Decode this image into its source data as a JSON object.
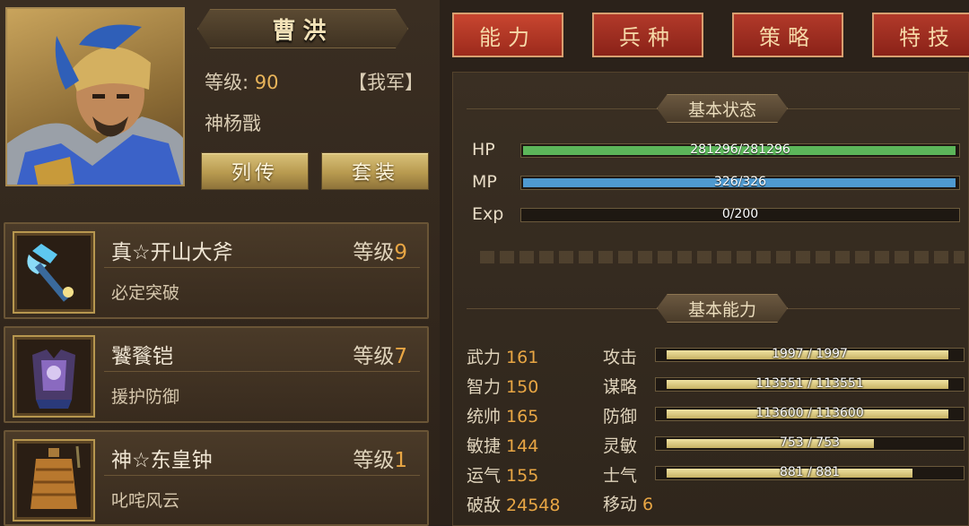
{
  "hero": {
    "name": "曹洪",
    "level_label": "等级:",
    "level_value": "90",
    "faction": "【我军】",
    "title": "神杨戬",
    "btn_biography": "列传",
    "btn_set": "套装"
  },
  "tabs": [
    {
      "label": "能力"
    },
    {
      "label": "兵种"
    },
    {
      "label": "策略"
    },
    {
      "label": "特技"
    }
  ],
  "equipment": [
    {
      "name": "真☆开山大斧",
      "level_label": "等级",
      "level": "9",
      "desc": "必定突破",
      "icon": "axe-icon"
    },
    {
      "name": "饕餮铠",
      "level_label": "等级",
      "level": "7",
      "desc": "援护防御",
      "icon": "armor-icon"
    },
    {
      "name": "神☆东皇钟",
      "level_label": "等级",
      "level": "1",
      "desc": "叱咤风云",
      "icon": "bell-icon"
    }
  ],
  "basic_status": {
    "title": "基本状态",
    "bars": [
      {
        "label": "HP",
        "text": "281296/281296",
        "fraction": 1.0,
        "color": "#5cb65a"
      },
      {
        "label": "MP",
        "text": "326/326",
        "fraction": 1.0,
        "color": "#4f9ad0"
      },
      {
        "label": "Exp",
        "text": "0/200",
        "fraction": 0.0,
        "color": "#c8b060"
      }
    ]
  },
  "basic_ability": {
    "title": "基本能力",
    "stats": [
      {
        "label": "武力",
        "value": "161"
      },
      {
        "label": "智力",
        "value": "150"
      },
      {
        "label": "统帅",
        "value": "165"
      },
      {
        "label": "敏捷",
        "value": "144"
      },
      {
        "label": "运气",
        "value": "155"
      },
      {
        "label": "破敌",
        "value": "24548"
      }
    ],
    "bars": [
      {
        "label": "攻击",
        "text": "1997 / 1997",
        "fraction": 0.95
      },
      {
        "label": "谋略",
        "text": "113551 / 113551",
        "fraction": 0.95
      },
      {
        "label": "防御",
        "text": "113600 / 113600",
        "fraction": 0.95
      },
      {
        "label": "灵敏",
        "text": "753 / 753",
        "fraction": 0.7
      },
      {
        "label": "士气",
        "text": "881 / 881",
        "fraction": 0.83
      }
    ],
    "move_label": "移动",
    "move_value": "6"
  }
}
